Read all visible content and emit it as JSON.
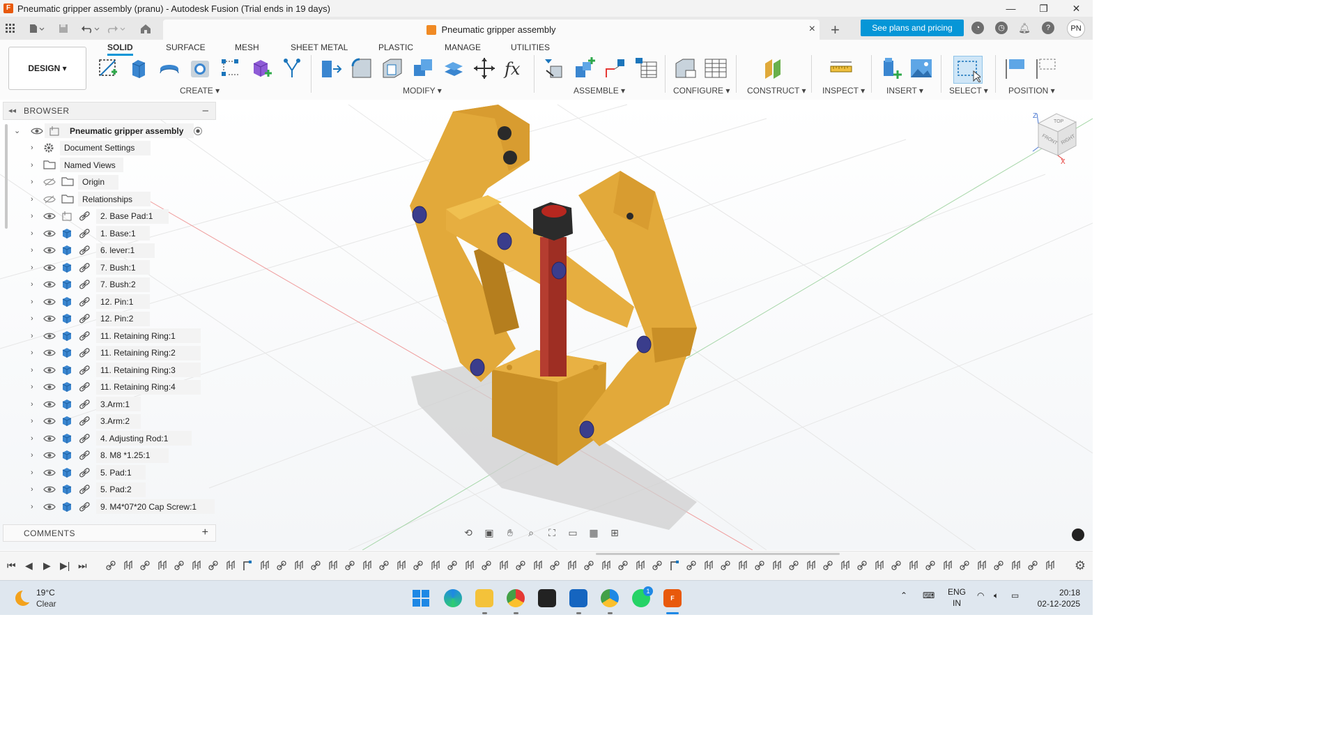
{
  "window": {
    "title": "Pneumatic gripper assembly (pranu) - Autodesk Fusion (Trial ends in 19 days)",
    "minimize": "—",
    "maximize": "❐",
    "close": "✕"
  },
  "tabbar": {
    "doc_tab": "Pneumatic gripper assembly",
    "close": "×",
    "new_tab": "+",
    "plans_button": "See plans and pricing",
    "avatar": "PN"
  },
  "ribbon": {
    "workspace": "DESIGN ▾",
    "tabs": [
      "SOLID",
      "SURFACE",
      "MESH",
      "SHEET METAL",
      "PLASTIC",
      "MANAGE",
      "UTILITIES"
    ],
    "groups": [
      "CREATE ▾",
      "MODIFY ▾",
      "ASSEMBLE ▾",
      "CONFIGURE ▾",
      "CONSTRUCT ▾",
      "INSPECT ▾",
      "INSERT ▾",
      "SELECT ▾",
      "POSITION ▾"
    ]
  },
  "browser": {
    "header": "BROWSER",
    "root": "Pneumatic gripper assembly",
    "items": [
      "Document Settings",
      "Named Views",
      "Origin",
      "Relationships",
      "2. Base Pad:1",
      "1. Base:1",
      "6. lever:1",
      "7. Bush:1",
      "7. Bush:2",
      "12. Pin:1",
      "12. Pin:2",
      "11. Retaining Ring:1",
      "11. Retaining Ring:2",
      "11. Retaining Ring:3",
      "11. Retaining Ring:4",
      "3.Arm:1",
      "3.Arm:2",
      "4. Adjusting Rod:1",
      "8. M8 *1.25:1",
      "5. Pad:1",
      "5. Pad:2",
      "9. M4*07*20 Cap Screw:1"
    ]
  },
  "comments": {
    "label": "COMMENTS",
    "add": "+"
  },
  "viewcube": {
    "top": "TOP",
    "front": "FRONT",
    "right": "RIGHT",
    "z": "Z",
    "x": "X"
  },
  "taskbar": {
    "temp": "19°C",
    "condition": "Clear",
    "lang1": "ENG",
    "lang2": "IN",
    "time": "20:18",
    "date": "02-12-2025",
    "whatsapp_badge": "1"
  }
}
